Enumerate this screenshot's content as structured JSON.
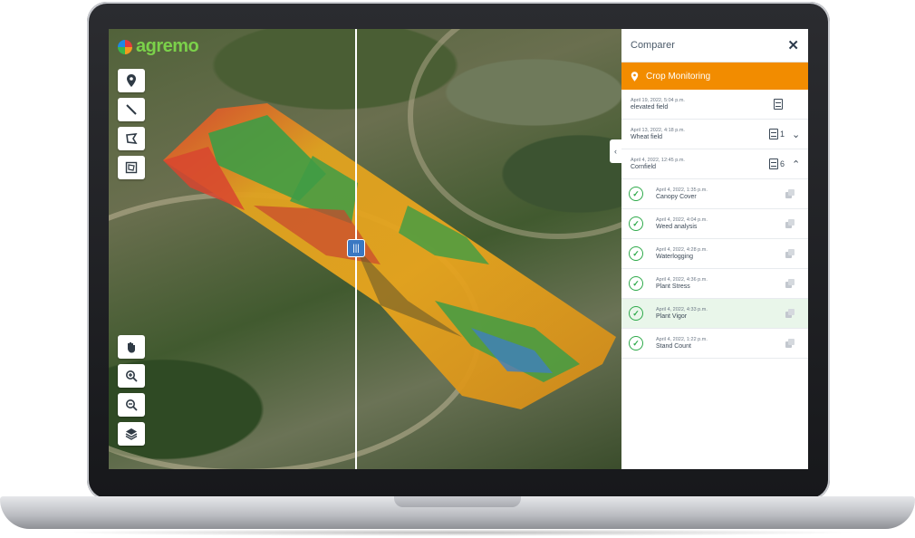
{
  "app": {
    "logo_text": "agremo"
  },
  "map": {
    "tools_top": [
      {
        "name": "pin-icon",
        "glyph": "⚲"
      },
      {
        "name": "line-icon",
        "glyph": "╲"
      },
      {
        "name": "polygon-icon",
        "glyph": "⬠"
      },
      {
        "name": "crop-area-icon",
        "glyph": "▣"
      }
    ],
    "tools_bottom": [
      {
        "name": "pan-icon",
        "glyph": "✋"
      },
      {
        "name": "zoom-in-icon",
        "glyph": "⊕"
      },
      {
        "name": "zoom-out-icon",
        "glyph": "⊖"
      },
      {
        "name": "layers-icon",
        "glyph": "≋"
      }
    ],
    "swipe_handle_glyph": "|||"
  },
  "panel": {
    "title": "Comparer",
    "close_glyph": "✕",
    "section_label": "Crop Monitoring",
    "fields": [
      {
        "date": "April 19, 2022, 5:04 p.m.",
        "name": "elevated field",
        "count": "",
        "chevron": ""
      },
      {
        "date": "April 13, 2022, 4:18 p.m.",
        "name": "Wheat field",
        "count": "1",
        "chevron": "⌄"
      },
      {
        "date": "April 4, 2022, 12:45 p.m.",
        "name": "Cornfield",
        "count": "6",
        "chevron": "⌃"
      }
    ],
    "analyses": [
      {
        "date": "April 4, 2022, 1:35 p.m.",
        "name": "Canopy Cover"
      },
      {
        "date": "April 4, 2022, 4:04 p.m.",
        "name": "Weed analysis"
      },
      {
        "date": "April 4, 2022, 4:28 p.m.",
        "name": "Waterlogging"
      },
      {
        "date": "April 4, 2022, 4:36 p.m.",
        "name": "Plant Stress"
      },
      {
        "date": "April 4, 2022, 4:33 p.m.",
        "name": "Plant Vigor"
      },
      {
        "date": "April 4, 2022, 1:22 p.m.",
        "name": "Stand Count"
      }
    ]
  }
}
